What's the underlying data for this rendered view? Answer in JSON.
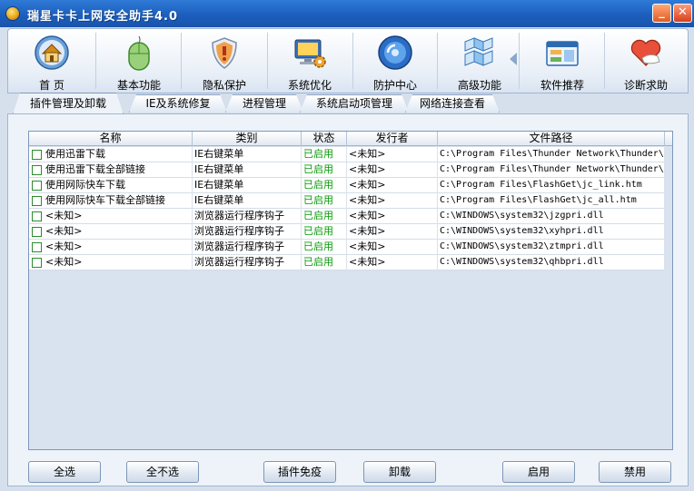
{
  "window": {
    "title": "瑞星卡卡上网安全助手4.0",
    "minimize_label": "_",
    "close_label": "✕"
  },
  "toolbar": {
    "items": [
      {
        "label": "首 页",
        "icon": "home-icon"
      },
      {
        "label": "基本功能",
        "icon": "mouse-icon"
      },
      {
        "label": "隐私保护",
        "icon": "shield-icon"
      },
      {
        "label": "系统优化",
        "icon": "monitor-gear-icon"
      },
      {
        "label": "防护中心",
        "icon": "globe-icon"
      },
      {
        "label": "高级功能",
        "icon": "cubes-icon"
      },
      {
        "label": "软件推荐",
        "icon": "window-icon"
      },
      {
        "label": "诊断求助",
        "icon": "heart-hand-icon"
      }
    ]
  },
  "tabs": [
    {
      "label": "插件管理及卸载"
    },
    {
      "label": "IE及系统修复"
    },
    {
      "label": "进程管理"
    },
    {
      "label": "系统启动项管理"
    },
    {
      "label": "网络连接查看"
    }
  ],
  "table": {
    "columns": [
      "名称",
      "类别",
      "状态",
      "发行者",
      "文件路径"
    ],
    "rows": [
      {
        "name": "使用迅雷下载",
        "category": "IE右键菜单",
        "status": "已启用",
        "publisher": "<未知>",
        "path": "C:\\Program Files\\Thunder Network\\Thunder\\"
      },
      {
        "name": "使用迅雷下载全部链接",
        "category": "IE右键菜单",
        "status": "已启用",
        "publisher": "<未知>",
        "path": "C:\\Program Files\\Thunder Network\\Thunder\\"
      },
      {
        "name": "使用网际快车下载",
        "category": "IE右键菜单",
        "status": "已启用",
        "publisher": "<未知>",
        "path": "C:\\Program Files\\FlashGet\\jc_link.htm"
      },
      {
        "name": "使用网际快车下载全部链接",
        "category": "IE右键菜单",
        "status": "已启用",
        "publisher": "<未知>",
        "path": "C:\\Program Files\\FlashGet\\jc_all.htm"
      },
      {
        "name": "<未知>",
        "category": "浏览器运行程序钩子",
        "status": "已启用",
        "publisher": "<未知>",
        "path": "C:\\WINDOWS\\system32\\jzgpri.dll"
      },
      {
        "name": "<未知>",
        "category": "浏览器运行程序钩子",
        "status": "已启用",
        "publisher": "<未知>",
        "path": "C:\\WINDOWS\\system32\\xyhpri.dll"
      },
      {
        "name": "<未知>",
        "category": "浏览器运行程序钩子",
        "status": "已启用",
        "publisher": "<未知>",
        "path": "C:\\WINDOWS\\system32\\ztmpri.dll"
      },
      {
        "name": "<未知>",
        "category": "浏览器运行程序钩子",
        "status": "已启用",
        "publisher": "<未知>",
        "path": "C:\\WINDOWS\\system32\\qhbpri.dll"
      }
    ]
  },
  "buttons": {
    "select_all": "全选",
    "select_none": "全不选",
    "plugin_immunity": "插件免疫",
    "uninstall": "卸载",
    "enable": "启用",
    "disable": "禁用"
  },
  "colors": {
    "status_enabled": "#0a9a0a",
    "titlebar": "#1c5fbd"
  }
}
